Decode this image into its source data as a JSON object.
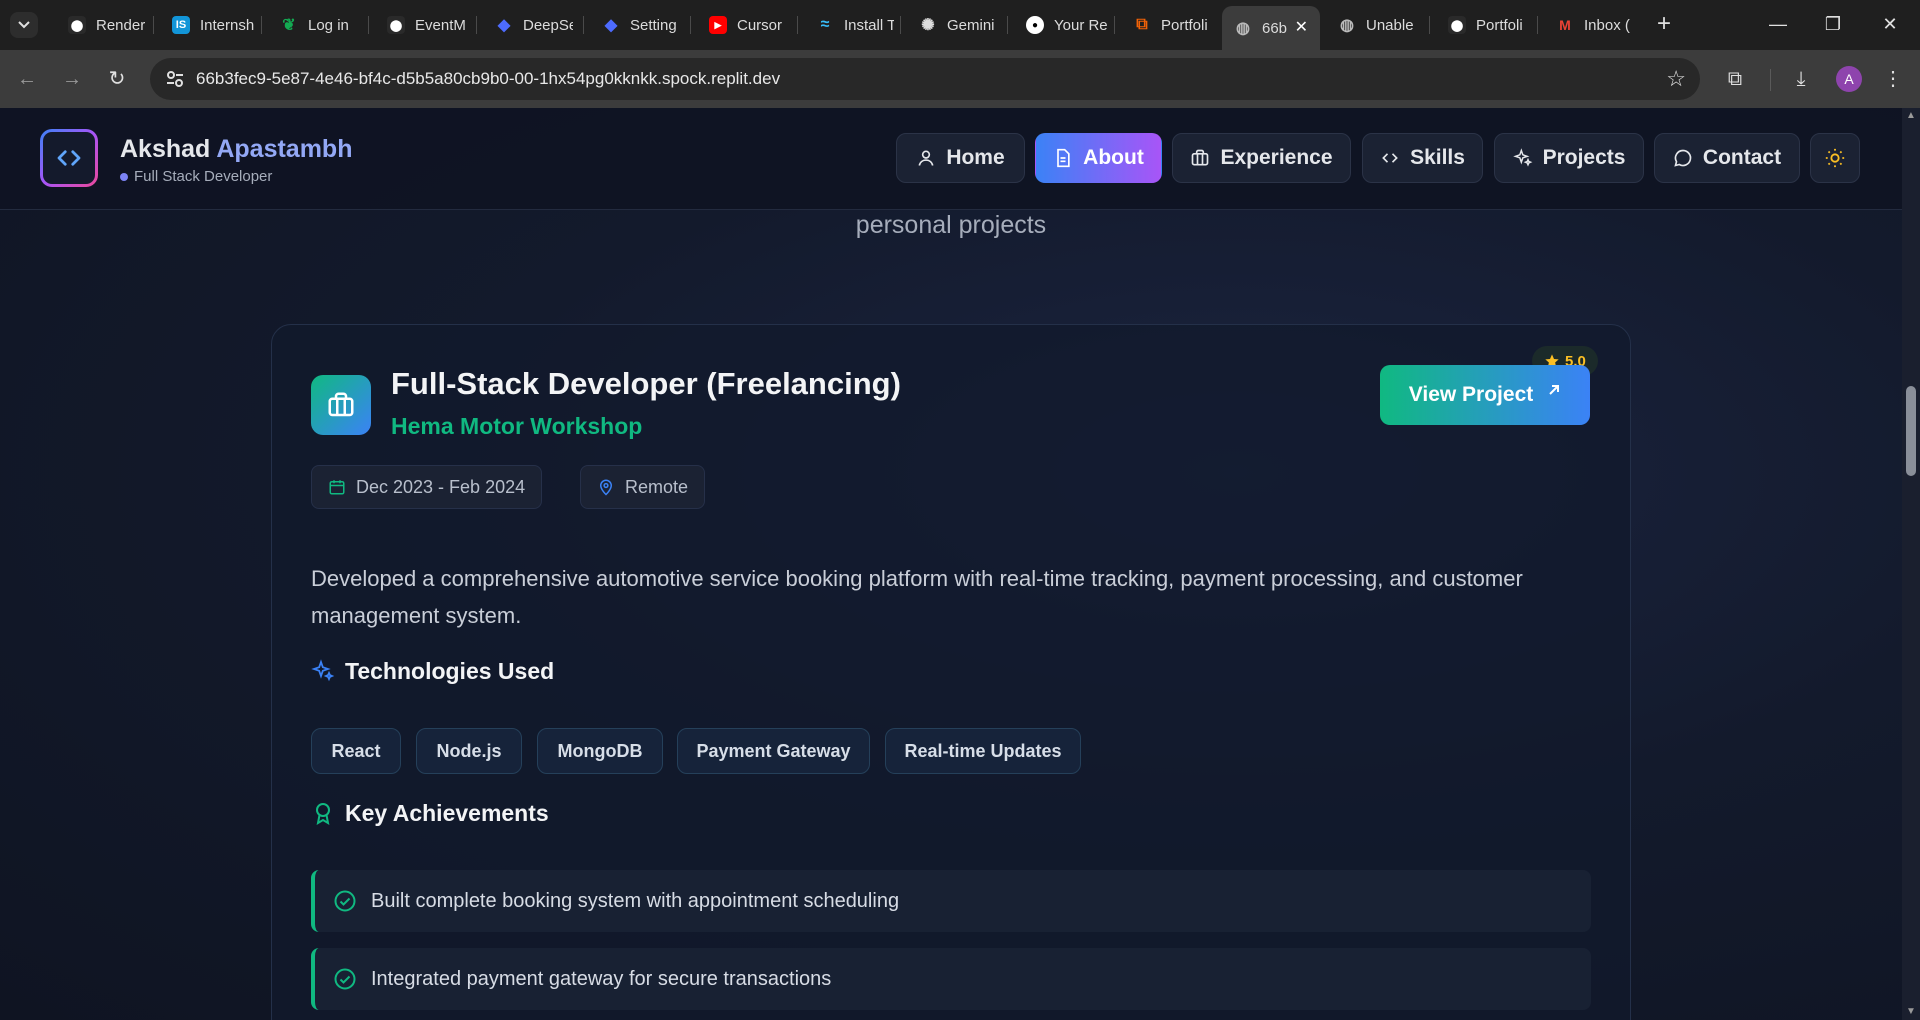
{
  "browser": {
    "tabs": [
      {
        "title": "Render",
        "icon": "render-icon",
        "color": "#ffffff"
      },
      {
        "title": "Internsh",
        "icon": "internshala-icon",
        "color": "#1295d8"
      },
      {
        "title": "Log in",
        "icon": "mongodb-leaf-icon",
        "color": "#13aa52"
      },
      {
        "title": "EventM",
        "icon": "render-icon",
        "color": "#ffffff"
      },
      {
        "title": "DeepSe",
        "icon": "deepseek-icon",
        "color": "#4d6bfe"
      },
      {
        "title": "Setting",
        "icon": "deepseek-icon",
        "color": "#4d6bfe"
      },
      {
        "title": "Cursor",
        "icon": "youtube-icon",
        "color": "#ff0000"
      },
      {
        "title": "Install T",
        "icon": "tailwind-icon",
        "color": "#38bdf8"
      },
      {
        "title": "Gemini",
        "icon": "openai-icon",
        "color": "#dddddd"
      },
      {
        "title": "Your Re",
        "icon": "github-icon",
        "color": "#ffffff"
      },
      {
        "title": "Portfoli",
        "icon": "replit-icon",
        "color": "#f26207"
      },
      {
        "title": "66b",
        "icon": "globe-icon",
        "color": "#bbbbbb"
      },
      {
        "title": "Unable",
        "icon": "globe-icon",
        "color": "#bbbbbb"
      },
      {
        "title": "Portfoli",
        "icon": "render-error-icon",
        "color": "#ffffff"
      },
      {
        "title": "Inbox (",
        "icon": "gmail-icon",
        "color": "#ea4335"
      }
    ],
    "active_tab_index": 11,
    "url": "66b3fec9-5e87-4e46-bf4c-d5b5a80cb9b0-00-1hx54pg0kknkk.spock.replit.dev",
    "profile_initial": "A"
  },
  "site": {
    "brand_first": "Akshad",
    "brand_last": "Apastambh",
    "brand_subtitle": "Full Stack Developer",
    "nav": [
      {
        "label": "Home",
        "icon": "user-icon"
      },
      {
        "label": "About",
        "icon": "document-icon",
        "active": true
      },
      {
        "label": "Experience",
        "icon": "briefcase-icon"
      },
      {
        "label": "Skills",
        "icon": "code-icon"
      },
      {
        "label": "Projects",
        "icon": "sparkles-icon"
      },
      {
        "label": "Contact",
        "icon": "chat-bubble-icon"
      }
    ],
    "theme_toggle_icon": "sun-icon"
  },
  "content": {
    "intro_tail": "personal projects",
    "card": {
      "title": "Full-Stack Developer (Freelancing)",
      "company": "Hema Motor Workshop",
      "rating": "5.0",
      "view_button": "View Project",
      "dates": "Dec 2023 - Feb 2024",
      "location": "Remote",
      "description": "Developed a comprehensive automotive service booking platform with real-time tracking, payment processing, and customer management system.",
      "tech_heading": "Technologies Used",
      "technologies": [
        "React",
        "Node.js",
        "MongoDB",
        "Payment Gateway",
        "Real-time Updates"
      ],
      "achievements_heading": "Key Achievements",
      "achievements": [
        "Built complete booking system with appointment scheduling",
        "Integrated payment gateway for secure transactions"
      ]
    }
  },
  "colors": {
    "accent_green": "#10b981",
    "accent_blue": "#3b82f6",
    "accent_purple": "#a855f7",
    "rating_gold": "#fbbf24"
  }
}
